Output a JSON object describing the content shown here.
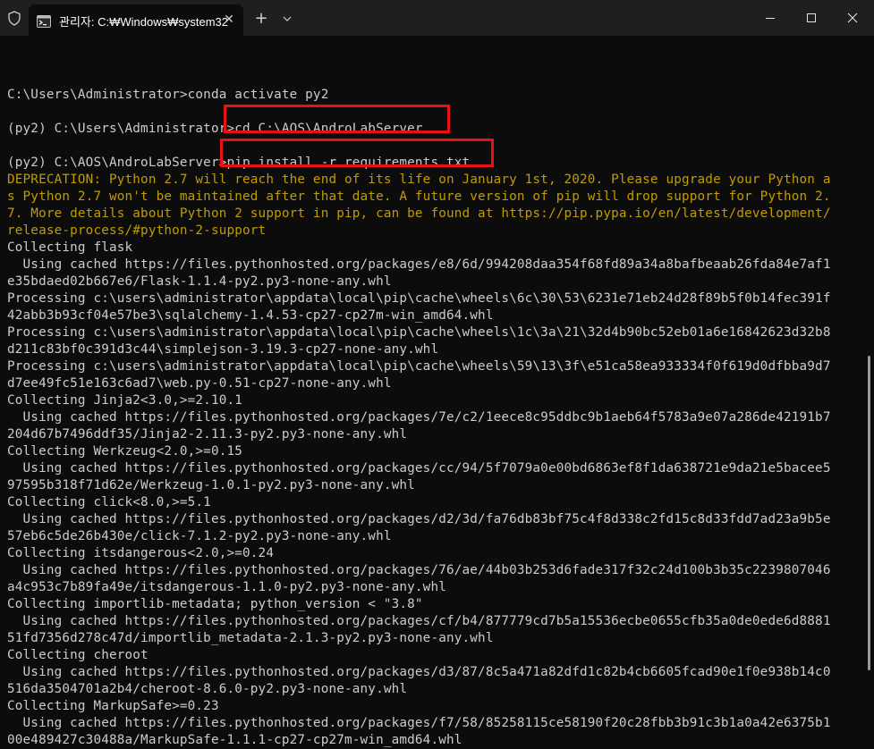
{
  "window": {
    "tab_title": "관리자: C:₩Windows₩system32",
    "tab_close": "✕",
    "new_tab": "+",
    "dropdown": "⌄"
  },
  "terminal": {
    "lines": [
      {
        "text": "",
        "style": "normal"
      },
      {
        "text": "C:\\Users\\Administrator>conda activate py2",
        "style": "normal"
      },
      {
        "text": "",
        "style": "normal"
      },
      {
        "text": "(py2) C:\\Users\\Administrator>cd C:\\AOS\\AndroLabServer",
        "style": "normal"
      },
      {
        "text": "",
        "style": "normal"
      },
      {
        "text": "(py2) C:\\AOS\\AndroLabServer>pip install -r requirements.txt",
        "style": "normal"
      },
      {
        "text": "DEPRECATION: Python 2.7 will reach the end of its life on January 1st, 2020. Please upgrade your Python a",
        "style": "warn"
      },
      {
        "text": "s Python 2.7 won't be maintained after that date. A future version of pip will drop support for Python 2.",
        "style": "warn"
      },
      {
        "text": "7. More details about Python 2 support in pip, can be found at https://pip.pypa.io/en/latest/development/",
        "style": "warn"
      },
      {
        "text": "release-process/#python-2-support",
        "style": "warn"
      },
      {
        "text": "Collecting flask",
        "style": "normal"
      },
      {
        "text": "  Using cached https://files.pythonhosted.org/packages/e8/6d/994208daa354f68fd89a34a8bafbeaab26fda84e7af1",
        "style": "normal"
      },
      {
        "text": "e35bdaed02b667e6/Flask-1.1.4-py2.py3-none-any.whl",
        "style": "normal"
      },
      {
        "text": "Processing c:\\users\\administrator\\appdata\\local\\pip\\cache\\wheels\\6c\\30\\53\\6231e71eb24d28f89b5f0b14fec391f",
        "style": "normal"
      },
      {
        "text": "42abb3b93cf04e57be3\\sqlalchemy-1.4.53-cp27-cp27m-win_amd64.whl",
        "style": "normal"
      },
      {
        "text": "Processing c:\\users\\administrator\\appdata\\local\\pip\\cache\\wheels\\1c\\3a\\21\\32d4b90bc52eb01a6e16842623d32b8",
        "style": "normal"
      },
      {
        "text": "d211c83bf0c391d3c44\\simplejson-3.19.3-cp27-none-any.whl",
        "style": "normal"
      },
      {
        "text": "Processing c:\\users\\administrator\\appdata\\local\\pip\\cache\\wheels\\59\\13\\3f\\e51ca58ea933334f0f619d0dfbba9d7",
        "style": "normal"
      },
      {
        "text": "d7ee49fc51e163c6ad7\\web.py-0.51-cp27-none-any.whl",
        "style": "normal"
      },
      {
        "text": "Collecting Jinja2<3.0,>=2.10.1",
        "style": "normal"
      },
      {
        "text": "  Using cached https://files.pythonhosted.org/packages/7e/c2/1eece8c95ddbc9b1aeb64f5783a9e07a286de42191b7",
        "style": "normal"
      },
      {
        "text": "204d67b7496ddf35/Jinja2-2.11.3-py2.py3-none-any.whl",
        "style": "normal"
      },
      {
        "text": "Collecting Werkzeug<2.0,>=0.15",
        "style": "normal"
      },
      {
        "text": "  Using cached https://files.pythonhosted.org/packages/cc/94/5f7079a0e00bd6863ef8f1da638721e9da21e5bacee5",
        "style": "normal"
      },
      {
        "text": "97595b318f71d62e/Werkzeug-1.0.1-py2.py3-none-any.whl",
        "style": "normal"
      },
      {
        "text": "Collecting click<8.0,>=5.1",
        "style": "normal"
      },
      {
        "text": "  Using cached https://files.pythonhosted.org/packages/d2/3d/fa76db83bf75c4f8d338c2fd15c8d33fdd7ad23a9b5e",
        "style": "normal"
      },
      {
        "text": "57eb6c5de26b430e/click-7.1.2-py2.py3-none-any.whl",
        "style": "normal"
      },
      {
        "text": "Collecting itsdangerous<2.0,>=0.24",
        "style": "normal"
      },
      {
        "text": "  Using cached https://files.pythonhosted.org/packages/76/ae/44b03b253d6fade317f32c24d100b3b35c2239807046",
        "style": "normal"
      },
      {
        "text": "a4c953c7b89fa49e/itsdangerous-1.1.0-py2.py3-none-any.whl",
        "style": "normal"
      },
      {
        "text": "Collecting importlib-metadata; python_version < \"3.8\"",
        "style": "normal"
      },
      {
        "text": "  Using cached https://files.pythonhosted.org/packages/cf/b4/877779cd7b5a15536ecbe0655cfb35a0de0ede6d8881",
        "style": "normal"
      },
      {
        "text": "51fd7356d278c47d/importlib_metadata-2.1.3-py2.py3-none-any.whl",
        "style": "normal"
      },
      {
        "text": "Collecting cheroot",
        "style": "normal"
      },
      {
        "text": "  Using cached https://files.pythonhosted.org/packages/d3/87/8c5a471a82dfd1c82b4cb6605fcad90e1f0e938b14c0",
        "style": "normal"
      },
      {
        "text": "516da3504701a2b4/cheroot-8.6.0-py2.py3-none-any.whl",
        "style": "normal"
      },
      {
        "text": "Collecting MarkupSafe>=0.23",
        "style": "normal"
      },
      {
        "text": "  Using cached https://files.pythonhosted.org/packages/f7/58/85258115ce58190f20c28fbb3b91c3b1a0a42e6375b1",
        "style": "normal"
      },
      {
        "text": "00e489427c30488a/MarkupSafe-1.1.1-cp27-cp27m-win_amd64.whl",
        "style": "normal"
      }
    ]
  },
  "colors": {
    "terminal_bg": "#0c0c0c",
    "text": "#cccccc",
    "warning": "#c19c00",
    "highlight_box": "#e81010"
  },
  "icons": [
    "shield-icon",
    "terminal-app-icon",
    "close-icon",
    "plus-icon",
    "chevron-down-icon",
    "minimize-icon",
    "maximize-icon",
    "window-close-icon"
  ]
}
